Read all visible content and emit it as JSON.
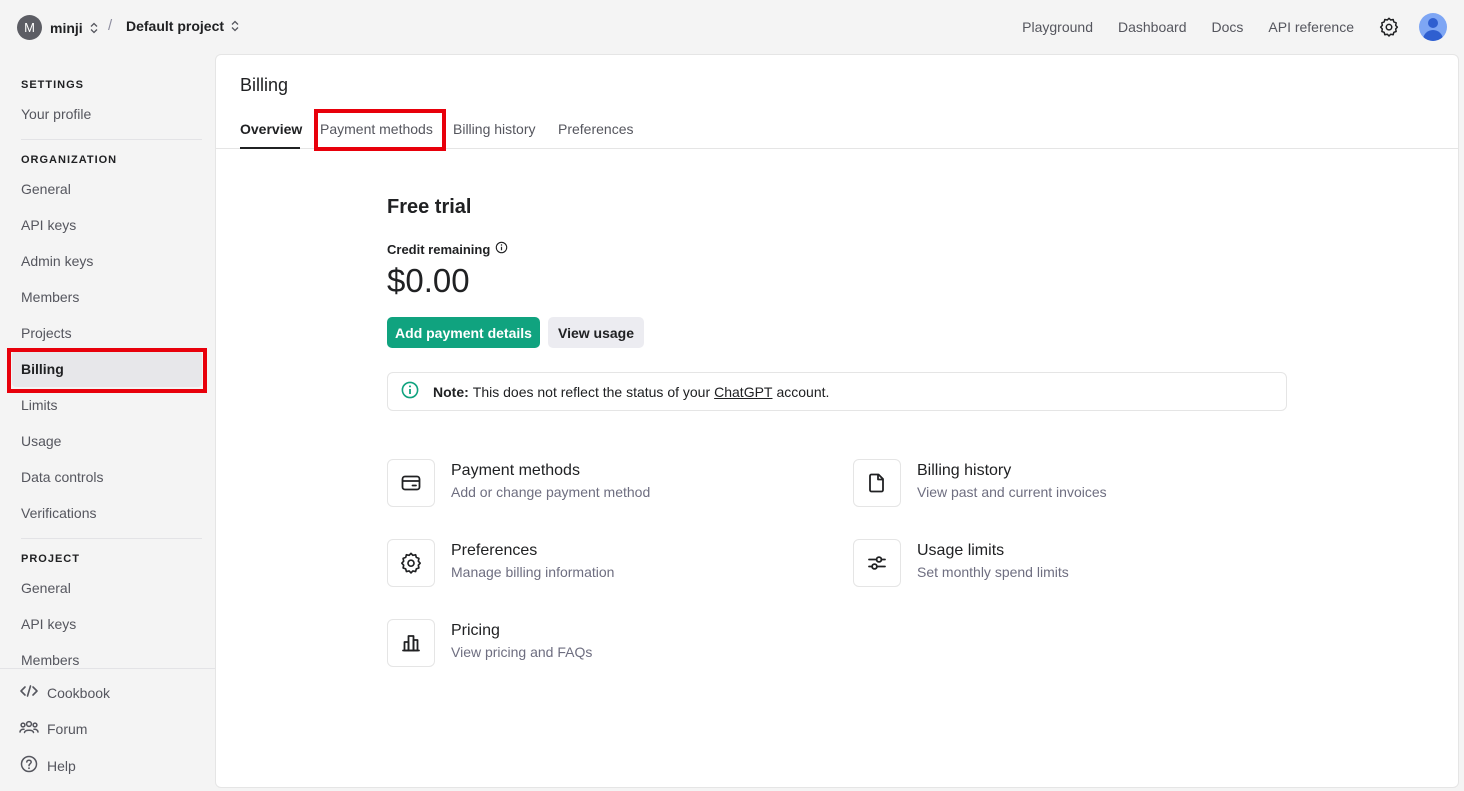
{
  "topbar": {
    "org_initial": "M",
    "org_name": "minji",
    "separator": "/",
    "project_name": "Default project",
    "nav": [
      "Playground",
      "Dashboard",
      "Docs",
      "API reference"
    ]
  },
  "sidebar": {
    "settings_title": "SETTINGS",
    "settings_items": [
      "Your profile"
    ],
    "organization_title": "ORGANIZATION",
    "organization_items": [
      "General",
      "API keys",
      "Admin keys",
      "Members",
      "Projects",
      "Billing",
      "Limits",
      "Usage",
      "Data controls",
      "Verifications"
    ],
    "active_item": "Billing",
    "project_title": "PROJECT",
    "project_items": [
      "General",
      "API keys",
      "Members"
    ],
    "bottom_items": [
      "Cookbook",
      "Forum",
      "Help"
    ]
  },
  "billing": {
    "title": "Billing",
    "tabs": [
      "Overview",
      "Payment methods",
      "Billing history",
      "Preferences"
    ],
    "active_tab": "Overview",
    "plan_title": "Free trial",
    "credit_label": "Credit remaining",
    "credit_amount": "$0.00",
    "primary_button": "Add payment details",
    "secondary_button": "View usage",
    "note_strong": "Note:",
    "note_text_before": "This does not reflect the status of your",
    "note_link": "ChatGPT",
    "note_text_after": "account.",
    "cards": [
      {
        "title": "Payment methods",
        "desc": "Add or change payment method",
        "icon": "credit-card-icon"
      },
      {
        "title": "Billing history",
        "desc": "View past and current invoices",
        "icon": "document-icon"
      },
      {
        "title": "Preferences",
        "desc": "Manage billing information",
        "icon": "gear-icon"
      },
      {
        "title": "Usage limits",
        "desc": "Set monthly spend limits",
        "icon": "sliders-icon"
      },
      {
        "title": "Pricing",
        "desc": "View pricing and FAQs",
        "icon": "bar-chart-icon"
      }
    ]
  },
  "colors": {
    "accent": "#10a37f",
    "highlight": "#e8000b",
    "sidebar_bg": "#f4f4f4",
    "active_bg": "#e7e7ea"
  }
}
